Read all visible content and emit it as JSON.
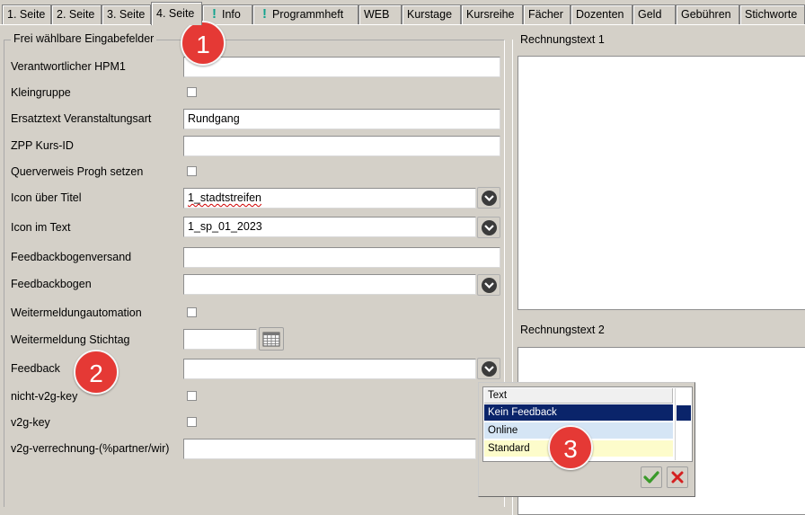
{
  "tabs": [
    {
      "label": "1. Seite"
    },
    {
      "label": "2. Seite"
    },
    {
      "label": "3. Seite"
    },
    {
      "label": "4. Seite",
      "active": true
    },
    {
      "label": "Info",
      "alert": true
    },
    {
      "label": "Programmheft",
      "alert": true
    },
    {
      "label": "WEB"
    },
    {
      "label": "Kurstage"
    },
    {
      "label": "Kursreihe"
    },
    {
      "label": "Fächer"
    },
    {
      "label": "Dozenten"
    },
    {
      "label": "Geld"
    },
    {
      "label": "Gebühren"
    },
    {
      "label": "Stichworte"
    }
  ],
  "left_group": {
    "title": "Frei wählbare Eingabefelder",
    "fields": {
      "verantwortlicher_label": "Verantwortlicher HPM1",
      "verantwortlicher_value": "",
      "kleingruppe_label": "Kleingruppe",
      "ersatztext_label": "Ersatztext Veranstaltungsart",
      "ersatztext_value": "Rundgang",
      "zpp_label": "ZPP Kurs-ID",
      "zpp_value": "",
      "querverweis_label": "Querverweis Progh setzen",
      "icon_titel_label": "Icon über Titel",
      "icon_titel_value": "1_stadtstreifen",
      "icon_text_label": "Icon im Text",
      "icon_text_value": "1_sp_01_2023",
      "feedbackversand_label": "Feedbackbogenversand",
      "feedbackversand_value": "",
      "feedbackbogen_label": "Feedbackbogen",
      "feedbackbogen_value": "",
      "weitermeldungautomation_label": "Weitermeldungautomation",
      "weitermeldung_stichtag_label": "Weitermeldung Stichtag",
      "weitermeldung_stichtag_value": "",
      "feedback_label": "Feedback",
      "feedback_value": "",
      "nicht_v2g_label": "nicht-v2g-key",
      "v2g_label": "v2g-key",
      "v2g_verrechnung_label": "v2g-verrechnung-(%partner/wir)",
      "v2g_verrechnung_value": ""
    }
  },
  "right_panels": {
    "rechnungstext1_title": "Rechnungstext 1",
    "rechnungstext2_title": "Rechnungstext 2"
  },
  "feedback_dropdown": {
    "column_header": "Text",
    "options": [
      "Kein Feedback",
      "Online",
      "Standard"
    ],
    "selected": "Kein Feedback"
  },
  "badges": [
    "1",
    "2",
    "3"
  ],
  "colors": {
    "window_bg": "#d4d0c8",
    "alert_icon": "#12a38e",
    "badge": "#e53935",
    "selection": "#0a246a",
    "ok_green": "#3a9a2a",
    "cancel_red": "#d42020"
  }
}
